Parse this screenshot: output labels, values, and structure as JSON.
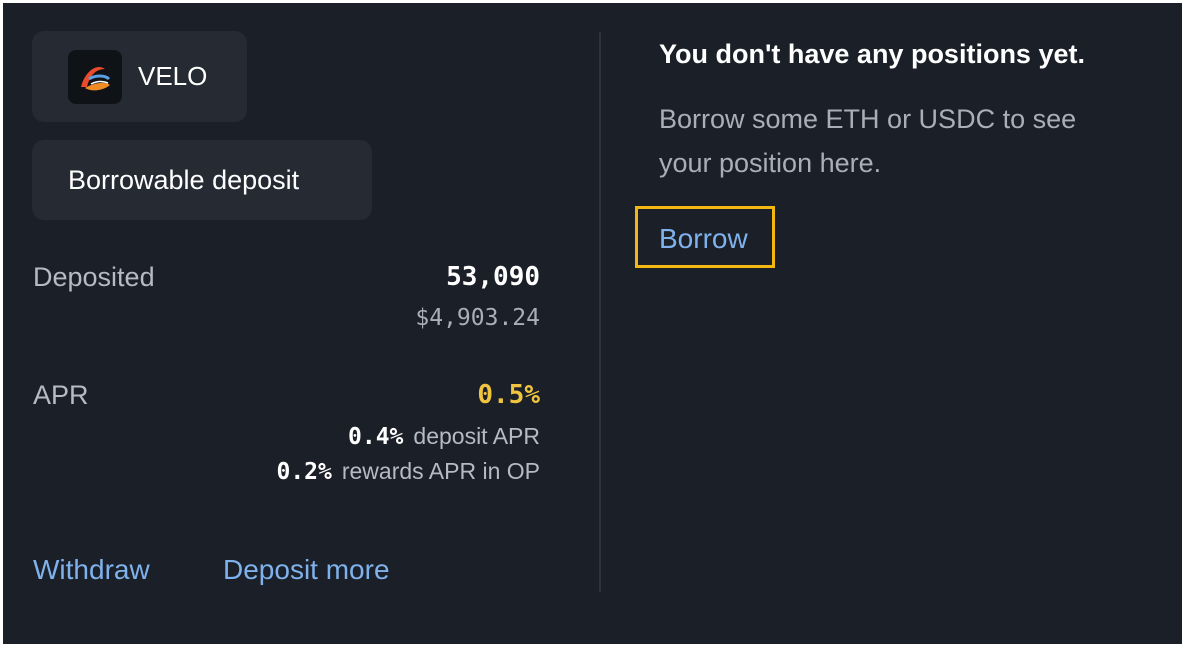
{
  "token": {
    "name": "VELO",
    "logo_icon": "velodrome-logo-icon"
  },
  "deposit_type": "Borrowable deposit",
  "deposited": {
    "label": "Deposited",
    "amount": "53,090",
    "usd": "$4,903.24"
  },
  "apr": {
    "label": "APR",
    "total": "0.5%",
    "deposit_value": "0.4%",
    "deposit_label": "deposit APR",
    "rewards_value": "0.2%",
    "rewards_label": "rewards APR in OP"
  },
  "actions": {
    "withdraw": "Withdraw",
    "deposit_more": "Deposit more"
  },
  "positions": {
    "empty_title": "You don't have any positions yet.",
    "empty_description": "Borrow some ETH or USDC to see your position here.",
    "borrow_label": "Borrow"
  },
  "colors": {
    "background": "#1b1f27",
    "accent_link": "#7fb2ec",
    "apr_highlight": "#f0c43f",
    "focus_outline": "#f3b711"
  }
}
